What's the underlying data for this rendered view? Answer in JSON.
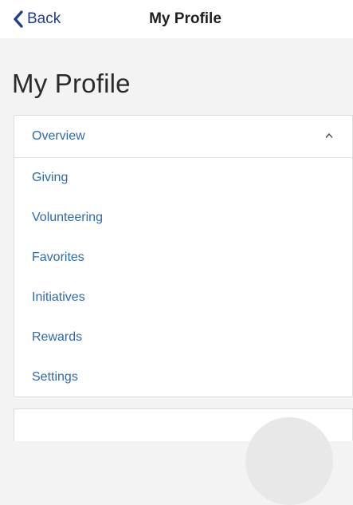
{
  "nav": {
    "back_label": "Back",
    "title": "My Profile"
  },
  "page": {
    "title": "My Profile"
  },
  "menu": {
    "header": "Overview",
    "items": [
      {
        "label": "Giving"
      },
      {
        "label": "Volunteering"
      },
      {
        "label": "Favorites"
      },
      {
        "label": "Initiatives"
      },
      {
        "label": "Rewards"
      },
      {
        "label": "Settings"
      }
    ]
  },
  "icons": {
    "back": "chevron-left-icon",
    "collapse": "chevron-up-icon"
  },
  "colors": {
    "nav_accent": "#1f3f86",
    "link": "#2f6aad",
    "background": "#f3f3f3"
  }
}
